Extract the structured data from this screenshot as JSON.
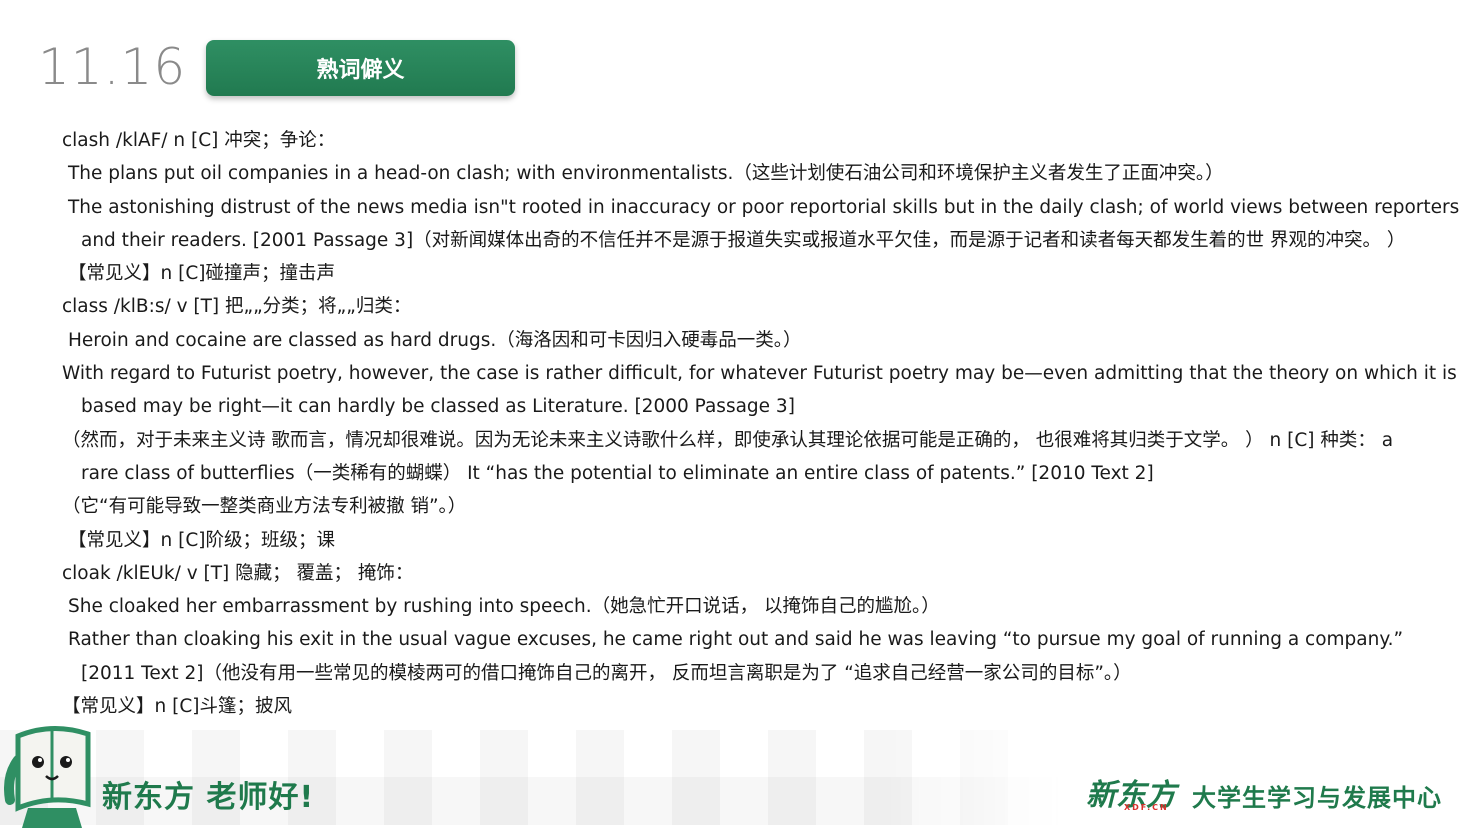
{
  "header": {
    "date": "11.16",
    "section_label": "熟词僻义"
  },
  "entries": [
    "clash /klAF/ n [C] 冲突；争论：",
    " The plans put oil companies in a head-on clash; with environmentalists.（这些计划使石油公司和环境保护主义者发生了正面冲突。）",
    " The astonishing distrust of the news media isn\"t rooted in inaccuracy or poor reportorial skills but in the daily clash; of world views between reporters",
    "and their readers. [2001 Passage 3]（对新闻媒体出奇的不信任并不是源于报道失实或报道水平欠佳，而是源于记者和读者每天都发生着的世 界观的冲突。 ）",
    " 【常见义】n [C]碰撞声；撞击声",
    "class /klB:s/ v [T] 把„„分类；将„„归类：",
    " Heroin and cocaine are classed as hard drugs.（海洛因和可卡因归入硬毒品一类。）",
    "With regard to Futurist poetry, however, the case is rather difficult, for whatever Futurist poetry may be—even admitting that the theory on which it is",
    "based may be right—it can hardly be classed as Literature. [2000 Passage 3]",
    "（然而，对于未来主义诗 歌而言，情况却很难说。因为无论未来主义诗歌什么样，即使承认其理论依据可能是正确的， 也很难将其归类于文学。 ） n [C] 种类： a",
    "rare class of butterflies（一类稀有的蝴蝶） It  “has the potential to eliminate an entire class of patents.”  [2010 Text 2]",
    "（它“有可能导致一整类商业方法专利被撤 销”。）",
    " 【常见义】n [C]阶级；班级；课",
    "cloak /klEUk/ v [T] 隐藏； 覆盖； 掩饰：",
    " She cloaked her embarrassment by rushing into speech.（她急忙开口说话， 以掩饰自己的尴尬。）",
    " Rather than cloaking his exit in the usual vague excuses, he came right out and said he was leaving  “to pursue my goal of running a company.”",
    "[2011 Text 2]（他没有用一些常见的模棱两可的借口掩饰自己的离开， 反而坦言离职是为了 “追求自己经营一家公司的目标”。）",
    "【常见义】n [C]斗篷；披风"
  ],
  "footer": {
    "slogan": "新东方 老师好!",
    "logo": "新东方",
    "logo_sub": "XDF.CN",
    "center_name": "大学生学习与发展中心"
  },
  "colors": {
    "brand_green": "#1f7a4c",
    "badge_green": "#2a8759",
    "date_gray": "#8a8a8a"
  }
}
